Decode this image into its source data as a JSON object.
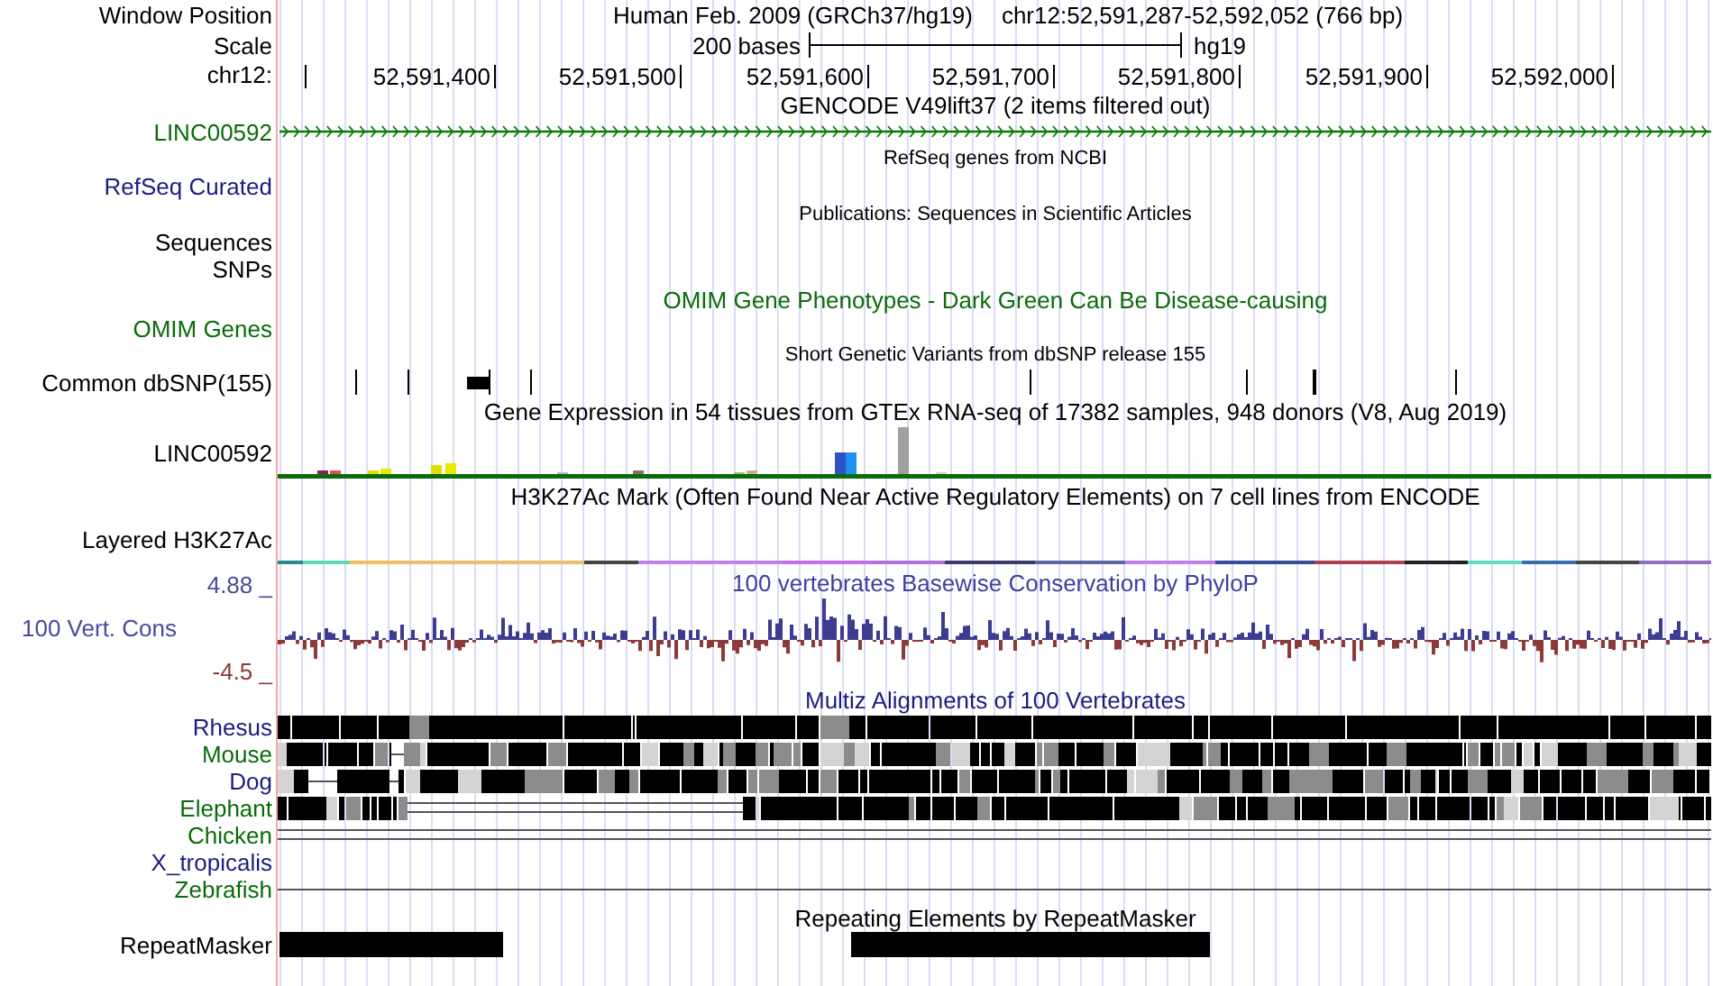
{
  "header": {
    "label": "Window Position",
    "title": "Human Feb. 2009 (GRCh37/hg19)",
    "position": "chr12:52,591,287-52,592,052 (766 bp)"
  },
  "scale": {
    "label": "Scale",
    "bar_label": "200 bases",
    "assembly": "hg19"
  },
  "ruler": {
    "label": "chr12:",
    "ticks": [
      "52,591,400",
      "52,591,500",
      "52,591,600",
      "52,591,700",
      "52,591,800",
      "52,591,900",
      "52,592,000"
    ]
  },
  "tracks": [
    {
      "kind": "gene",
      "title": "GENCODE V49lift37 (2 items filtered out)",
      "labels": [
        "LINC00592"
      ],
      "color": "#0b6b0b"
    },
    {
      "kind": "refseq",
      "title": "RefSeq genes from NCBI",
      "labels": [
        "RefSeq Curated"
      ],
      "color": "#1c1c80"
    },
    {
      "kind": "pubs",
      "title": "Publications: Sequences in Scientific Articles",
      "labels": [
        "Sequences",
        "SNPs"
      ],
      "color": "#000000"
    },
    {
      "kind": "omim",
      "title": "OMIM Gene Phenotypes - Dark Green Can Be Disease-causing",
      "labels": [
        "OMIM Genes"
      ],
      "color": "#0b6b0b"
    },
    {
      "kind": "snp",
      "title": "Short Genetic Variants from dbSNP release 155",
      "labels": [
        "Common dbSNP(155)"
      ],
      "color": "#000000"
    },
    {
      "kind": "expression",
      "title": "Gene Expression in 54 tissues from GTEx RNA-seq of 17382 samples, 948 donors (V8, Aug 2019)",
      "labels": [
        "LINC00592"
      ],
      "color": "#000000"
    },
    {
      "kind": "layered",
      "title": "H3K27Ac Mark (Often Found Near Active Regulatory Elements) on 7 cell lines from ENCODE",
      "labels": [
        "Layered H3K27Ac"
      ],
      "color": "#000000"
    },
    {
      "kind": "wiggle",
      "title": "100 vertebrates Basewise Conservation by PhyloP",
      "labels": [
        "100 Vert. Cons"
      ],
      "color": "#3f3f9f",
      "axis_labels": [
        {
          "text": "4.88 _",
          "color": "#4a4a9a"
        },
        {
          "text": "-4.5 _",
          "color": "#8b3a3a"
        }
      ]
    },
    {
      "kind": "multiz",
      "title": "Multiz Alignments of 100 Vertebrates",
      "color": "#1c1c80",
      "species": [
        {
          "name": "Rhesus",
          "color": "#1c1c80"
        },
        {
          "name": "Mouse",
          "color": "#0b6b0b"
        },
        {
          "name": "Dog",
          "color": "#1c1c80"
        },
        {
          "name": "Elephant",
          "color": "#0b6b0b"
        },
        {
          "name": "Chicken",
          "color": "#0b6b0b"
        },
        {
          "name": "X_tropicalis",
          "color": "#1c1c80"
        },
        {
          "name": "Zebrafish",
          "color": "#0b6b0b"
        }
      ]
    },
    {
      "kind": "repeat",
      "title": "Repeating Elements by RepeatMasker",
      "labels": [
        "RepeatMasker"
      ],
      "color": "#000000"
    }
  ]
}
